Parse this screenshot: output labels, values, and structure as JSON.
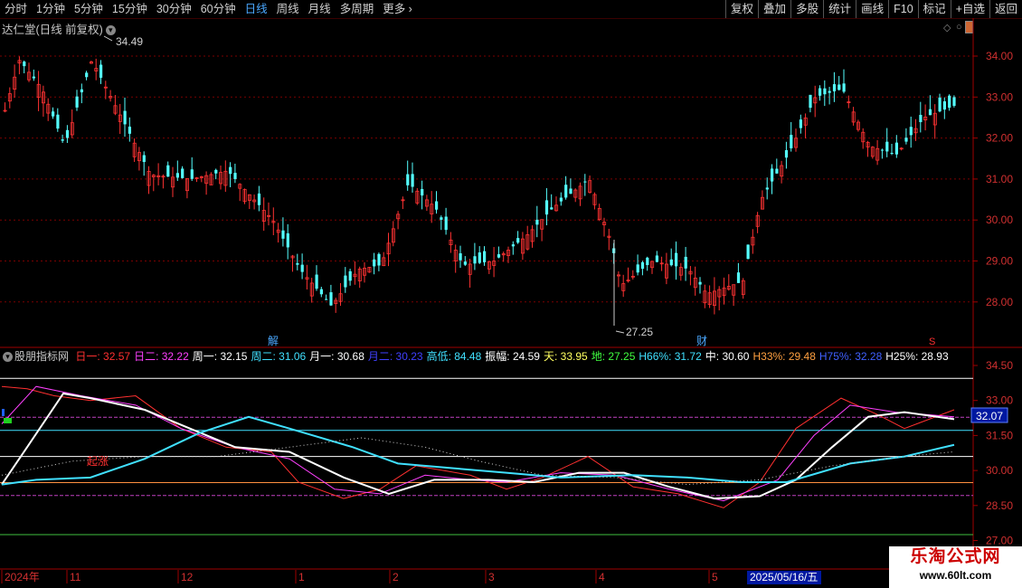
{
  "toolbar": {
    "tabs": [
      "分时",
      "1分钟",
      "5分钟",
      "15分钟",
      "30分钟",
      "60分钟",
      "日线",
      "周线",
      "月线",
      "多周期",
      "更多"
    ],
    "active": "日线",
    "right_buttons": [
      "复权",
      "叠加",
      "多股",
      "统计",
      "画线",
      "F10",
      "标记",
      "+自选",
      "返回"
    ]
  },
  "main": {
    "title": "达仁堂(日线 前复权)",
    "price_ticks": [
      "34.00",
      "33.00",
      "32.00",
      "31.00",
      "30.00",
      "29.00",
      "28.00"
    ],
    "high_label": "34.49",
    "low_label": "27.25",
    "markers": [
      "解",
      "财",
      "S"
    ]
  },
  "indicator": {
    "name": "股朋指标网",
    "items": [
      {
        "label": "日一: ",
        "value": "32.57",
        "color": "#ff3030"
      },
      {
        "label": "日二: ",
        "value": "32.22",
        "color": "#ff40ff"
      },
      {
        "label": "周一: ",
        "value": "32.15",
        "color": "#ffffff"
      },
      {
        "label": "周二: ",
        "value": "31.06",
        "color": "#40e0ff"
      },
      {
        "label": "月一: ",
        "value": "30.68",
        "color": "#ffffff"
      },
      {
        "label": "月二: ",
        "value": "30.23",
        "color": "#4040ff"
      },
      {
        "label": "高低: ",
        "value": "84.48",
        "color": "#40e0ff"
      },
      {
        "label": "振幅: ",
        "value": "24.59",
        "color": "#ffffff"
      },
      {
        "label": "天: ",
        "value": "33.95",
        "color": "#ffff60"
      },
      {
        "label": "地: ",
        "value": "27.25",
        "color": "#40ff40"
      },
      {
        "label": "H66%: ",
        "value": "31.72",
        "color": "#40e0ff"
      },
      {
        "label": "中: ",
        "value": "30.60",
        "color": "#ffffff"
      },
      {
        "label": "H33%: ",
        "value": "29.48",
        "color": "#ffa040"
      },
      {
        "label": "H75%: ",
        "value": "32.28",
        "color": "#4060ff"
      },
      {
        "label": "H25%: ",
        "value": "28.93",
        "color": "#ffffff"
      }
    ],
    "ticks": [
      "34.50",
      "33.00",
      "31.50",
      "30.00",
      "28.50",
      "27.00"
    ],
    "current_value": "32.07",
    "annotation": "起涨"
  },
  "dates": {
    "labels": [
      "2024年",
      "11",
      "12",
      "1",
      "2",
      "3",
      "4",
      "5"
    ],
    "cursor_date": "2025/05/16/五"
  },
  "watermark": {
    "line1": "乐淘公式网",
    "line2": "www.60lt.com"
  },
  "colors": {
    "up": "#ff3232",
    "down": "#54ffff",
    "bg": "#000000",
    "grid": "#7a0000"
  }
}
